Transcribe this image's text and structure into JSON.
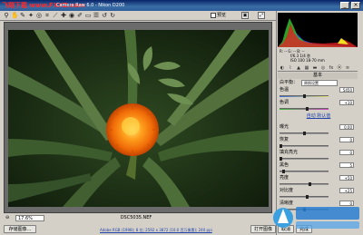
{
  "window": {
    "site_logo": "飞翔下载 www.FXXZ.com",
    "title": "Camera Raw 6.0 - Nikon D200"
  },
  "toolbar": {
    "preview_label": "预览"
  },
  "histogram": {
    "readout_rgb": "R: -- G: -- B: --",
    "readout_exp": "f/6.3 1/4 秒",
    "readout_iso": "ISO 100 18-70 mm"
  },
  "panel": {
    "title": "基本",
    "white_balance_label": "白平衡：",
    "white_balance_value": "原照设置",
    "sliders": [
      {
        "label": "色温",
        "value": "5450",
        "pos": 0.5,
        "track": "temp"
      },
      {
        "label": "色调",
        "value": "+10",
        "pos": 0.55,
        "track": "tint"
      },
      {
        "label": "曝光",
        "value": "0.00",
        "pos": 0.5
      },
      {
        "label": "恢复",
        "value": "0",
        "pos": 0.0
      },
      {
        "label": "填充亮光",
        "value": "0",
        "pos": 0.0
      },
      {
        "label": "黑色",
        "value": "5",
        "pos": 0.05
      },
      {
        "label": "亮度",
        "value": "+50",
        "pos": 0.62
      },
      {
        "label": "对比度",
        "value": "+25",
        "pos": 0.56
      },
      {
        "label": "清晰度",
        "value": "0",
        "pos": 0.5
      }
    ],
    "auto_label": "自动",
    "default_label": "默认值"
  },
  "bottom": {
    "zoom": "17.6%",
    "filename": "DSC5035.NEF",
    "info": "Adobe RGB (1998); 8 位; 2592 x 3872 (10.0 百万像素); 240 ppi"
  },
  "buttons": {
    "save": "存储图像...",
    "open": "打开图像",
    "cancel": "取消",
    "done": "完成"
  },
  "colors": {
    "title_bar": "#0a246a",
    "accent_logo": "#ff2a2a",
    "link": "#2244aa"
  }
}
